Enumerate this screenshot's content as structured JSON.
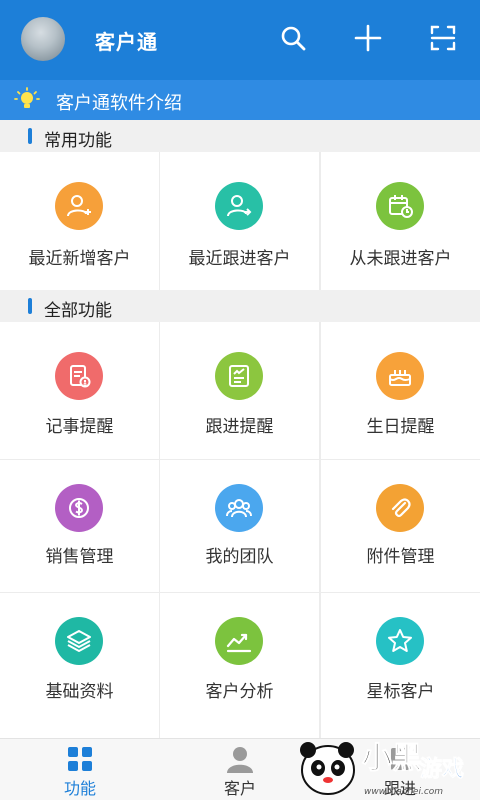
{
  "header": {
    "title": "客户通",
    "bg_color": "#1d7fd8",
    "icons": [
      "search-icon",
      "plus-icon",
      "scan-icon"
    ]
  },
  "intro": {
    "text": "客户通软件介绍",
    "bg_color": "#2f8be3"
  },
  "sections": {
    "common": {
      "title": "常用功能"
    },
    "all": {
      "title": "全部功能"
    }
  },
  "common_items": [
    {
      "label": "最近新增客户",
      "icon": "add-user-icon",
      "color": "#f6a03a"
    },
    {
      "label": "最近跟进客户",
      "icon": "followed-user-icon",
      "color": "#28c0a6"
    },
    {
      "label": "从未跟进客户",
      "icon": "calendar-clock-icon",
      "color": "#7cc33e"
    }
  ],
  "all_items": [
    {
      "label": "记事提醒",
      "icon": "note-alert-icon",
      "color": "#f06b6b"
    },
    {
      "label": "跟进提醒",
      "icon": "followup-notes-icon",
      "color": "#8cc63f"
    },
    {
      "label": "生日提醒",
      "icon": "birthday-cake-icon",
      "color": "#f7a23a"
    },
    {
      "label": "销售管理",
      "icon": "money-bag-icon",
      "color": "#b35fc4"
    },
    {
      "label": "我的团队",
      "icon": "team-icon",
      "color": "#4ba7ee"
    },
    {
      "label": "附件管理",
      "icon": "paperclip-icon",
      "color": "#f3a234"
    },
    {
      "label": "基础资料",
      "icon": "layers-icon",
      "color": "#1fb8a4"
    },
    {
      "label": "客户分析",
      "icon": "trend-chart-icon",
      "color": "#7cc33e"
    },
    {
      "label": "星标客户",
      "icon": "star-icon",
      "color": "#26c1c5"
    }
  ],
  "bottom_nav": [
    {
      "label": "功能",
      "icon": "grid-icon",
      "active": true,
      "color": "#1d7fd8"
    },
    {
      "label": "客户",
      "icon": "person-icon",
      "active": false,
      "color": "#333333"
    },
    {
      "label": "跟进",
      "icon": "followup-icon",
      "active": false,
      "color": "#333333"
    }
  ],
  "watermark": {
    "text": "小黑游戏",
    "url_text": "www.xiaohei.com"
  }
}
